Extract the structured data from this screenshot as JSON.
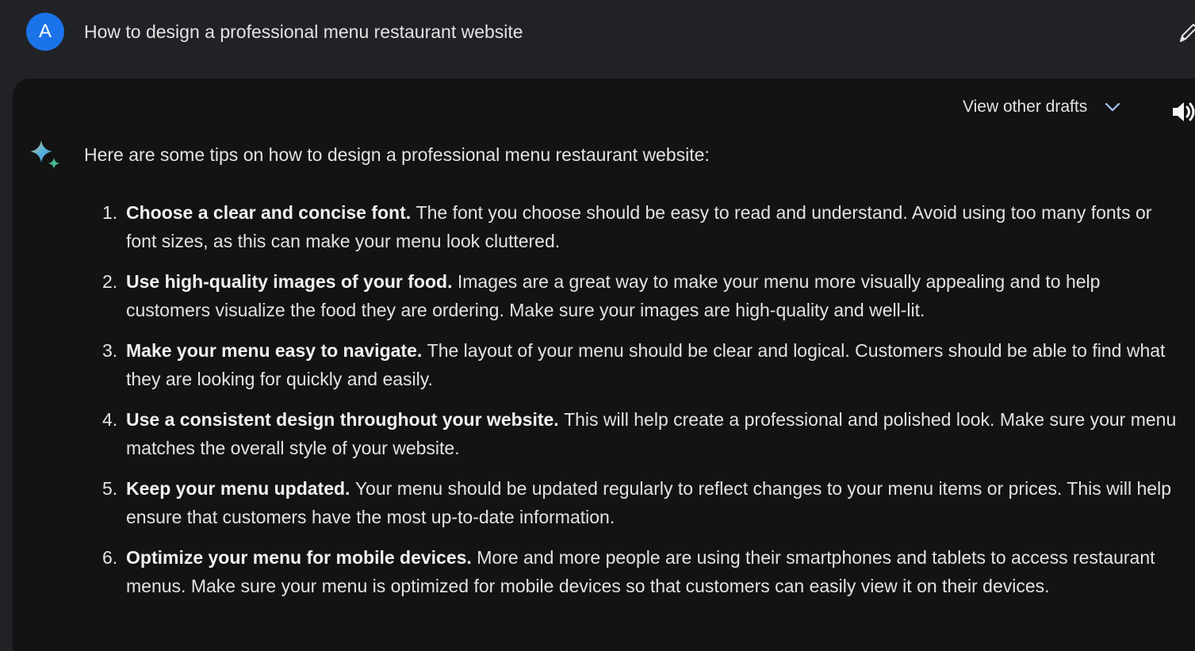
{
  "user": {
    "avatar_letter": "A",
    "prompt": "How to design a professional menu restaurant website"
  },
  "response": {
    "drafts_label": "View other drafts",
    "intro": "Here are some tips on how to design a professional menu restaurant website:",
    "tips": [
      {
        "number": "1.",
        "title": "Choose a clear and concise font.",
        "body": "The font you choose should be easy to read and understand. Avoid using too many fonts or font sizes, as this can make your menu look cluttered."
      },
      {
        "number": "2.",
        "title": "Use high-quality images of your food.",
        "body": "Images are a great way to make your menu more visually appealing and to help customers visualize the food they are ordering. Make sure your images are high-quality and well-lit."
      },
      {
        "number": "3.",
        "title": "Make your menu easy to navigate.",
        "body": "The layout of your menu should be clear and logical. Customers should be able to find what they are looking for quickly and easily."
      },
      {
        "number": "4.",
        "title": "Use a consistent design throughout your website.",
        "body": "This will help create a professional and polished look. Make sure your menu matches the overall style of your website."
      },
      {
        "number": "5.",
        "title": "Keep your menu updated.",
        "body": "Your menu should be updated regularly to reflect changes to your menu items or prices. This will help ensure that customers have the most up-to-date information."
      },
      {
        "number": "6.",
        "title": "Optimize your menu for mobile devices.",
        "body": "More and more people are using their smartphones and tablets to access restaurant menus. Make sure your menu is optimized for mobile devices so that customers can easily view it on their devices."
      }
    ]
  },
  "icons": {
    "edit": "pencil-icon",
    "drafts_toggle": "chevron-down-icon",
    "read_aloud": "speaker-icon",
    "assistant": "sparkle-icon"
  },
  "colors": {
    "page_background": "#212226",
    "card_background": "#131314",
    "avatar": "#1a73e8",
    "text": "#e3e3e3",
    "chevron": "#a8c7fa"
  }
}
